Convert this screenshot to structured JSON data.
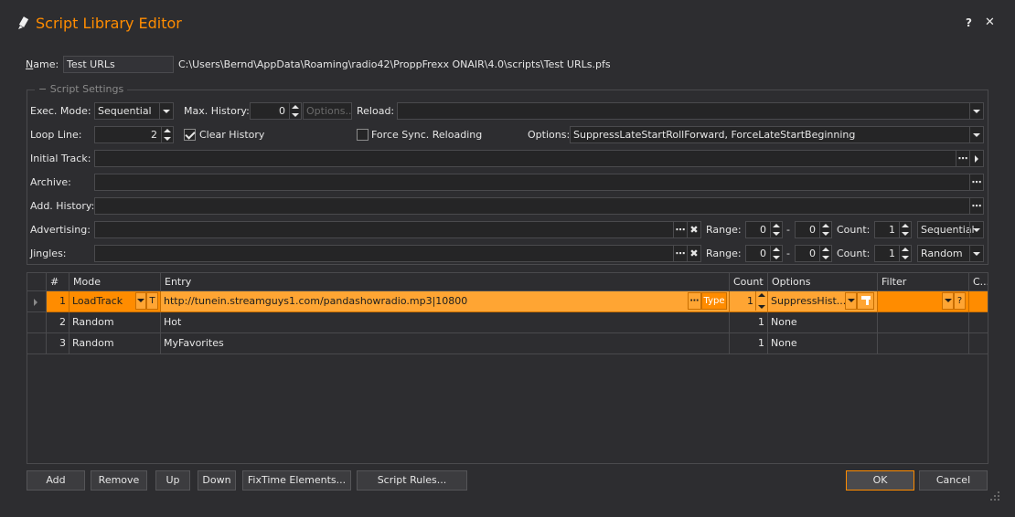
{
  "window": {
    "title": "Script Library Editor",
    "help_label": "?",
    "close_label": "✕"
  },
  "name": {
    "label_prefix": "N",
    "label_rest": "ame:",
    "value": "Test URLs",
    "path": "C:\\Users\\Bernd\\AppData\\Roaming\\radio42\\ProppFrexx ONAIR\\4.0\\scripts\\Test URLs.pfs"
  },
  "settings": {
    "group_label": "− Script Settings",
    "exec_mode": {
      "label": "Exec. Mode:",
      "value": "Sequential"
    },
    "max_history": {
      "label": "Max. History:",
      "value": "0",
      "options_button": "Options..."
    },
    "reload": {
      "label": "Reload:",
      "value": ""
    },
    "loop_line": {
      "label": "Loop Line:",
      "value": "2"
    },
    "clear_history": {
      "label": "Clear History",
      "checked": true
    },
    "force_sync": {
      "label": "Force Sync. Reloading",
      "checked": false
    },
    "options": {
      "label": "Options:",
      "value": "SuppressLateStartRollForward, ForceLateStartBeginning"
    },
    "initial_track": {
      "label": "Initial Track:",
      "value": ""
    },
    "archive": {
      "label": "Archive:",
      "value": ""
    },
    "add_history": {
      "label": "Add. History:",
      "value": ""
    },
    "advertising": {
      "label": "Advertising:",
      "value": "",
      "range_label": "Range:",
      "range_from": "0",
      "dash": "-",
      "range_to": "0",
      "count_label": "Count:",
      "count": "1",
      "mode": "Sequential"
    },
    "jingles": {
      "label": "Jingles:",
      "value": "",
      "range_label": "Range:",
      "range_from": "0",
      "dash": "-",
      "range_to": "0",
      "count_label": "Count:",
      "count": "1",
      "mode": "Random"
    },
    "ellipsis": "⋯",
    "clear_x": "✖"
  },
  "grid": {
    "columns": [
      "#",
      "Mode",
      "Entry",
      "Count",
      "Options",
      "Filter",
      "C..."
    ],
    "rows": [
      {
        "num": "1",
        "mode": "LoadTrack",
        "t_button": "T",
        "entry": "http://tunein.streamguys1.com/pandashowradio.mp3|10800",
        "entry_ellipsis": "⋯",
        "type_button": "Type",
        "count": "1",
        "options": "SuppressHist...",
        "filter": "",
        "filter_q": "?"
      },
      {
        "num": "2",
        "mode": "Random",
        "entry": "Hot",
        "count": "1",
        "options": "None",
        "filter": ""
      },
      {
        "num": "3",
        "mode": "Random",
        "entry": "MyFavorites",
        "count": "1",
        "options": "None",
        "filter": ""
      }
    ]
  },
  "buttons": {
    "add": "Add",
    "remove": "Remove",
    "up": "Up",
    "down": "Down",
    "fixtime": "FixTime Elements...",
    "script_rules": "Script Rules...",
    "ok": "OK",
    "cancel": "Cancel"
  },
  "colors": {
    "accent": "#ff8c00",
    "background": "#2d2d30",
    "field": "#252526"
  }
}
